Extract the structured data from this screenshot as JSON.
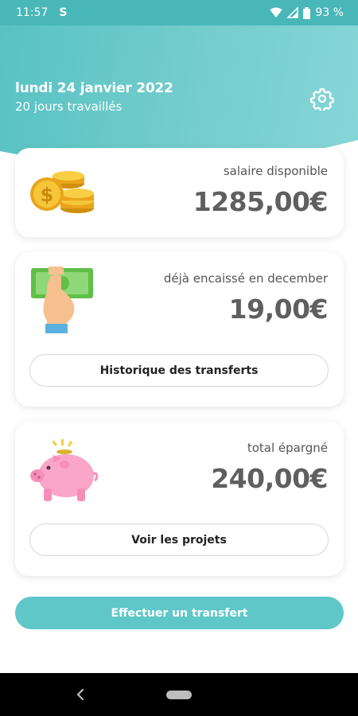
{
  "status_bar": {
    "time": "11:57",
    "app_icon": "S",
    "battery": "93 %"
  },
  "header": {
    "date": "lundi 24 janvier 2022",
    "days_worked": "20 jours travaillés",
    "settings_icon": "gear-icon"
  },
  "cards": {
    "salary": {
      "label": "salaire disponible",
      "amount": "1285,00€",
      "icon": "coins-icon"
    },
    "cashed": {
      "label": "déjà encaissé en december",
      "amount": "19,00€",
      "icon": "cash-hand-icon",
      "button": "Historique des transferts"
    },
    "saved": {
      "label": "total épargné",
      "amount": "240,00€",
      "icon": "piggy-bank-icon",
      "button": "Voir les projets"
    }
  },
  "primary_action": "Effectuer un transfert",
  "colors": {
    "accent": "#5fc7c8",
    "header": "#6ccaca",
    "amount_text": "#5f5f5f"
  }
}
